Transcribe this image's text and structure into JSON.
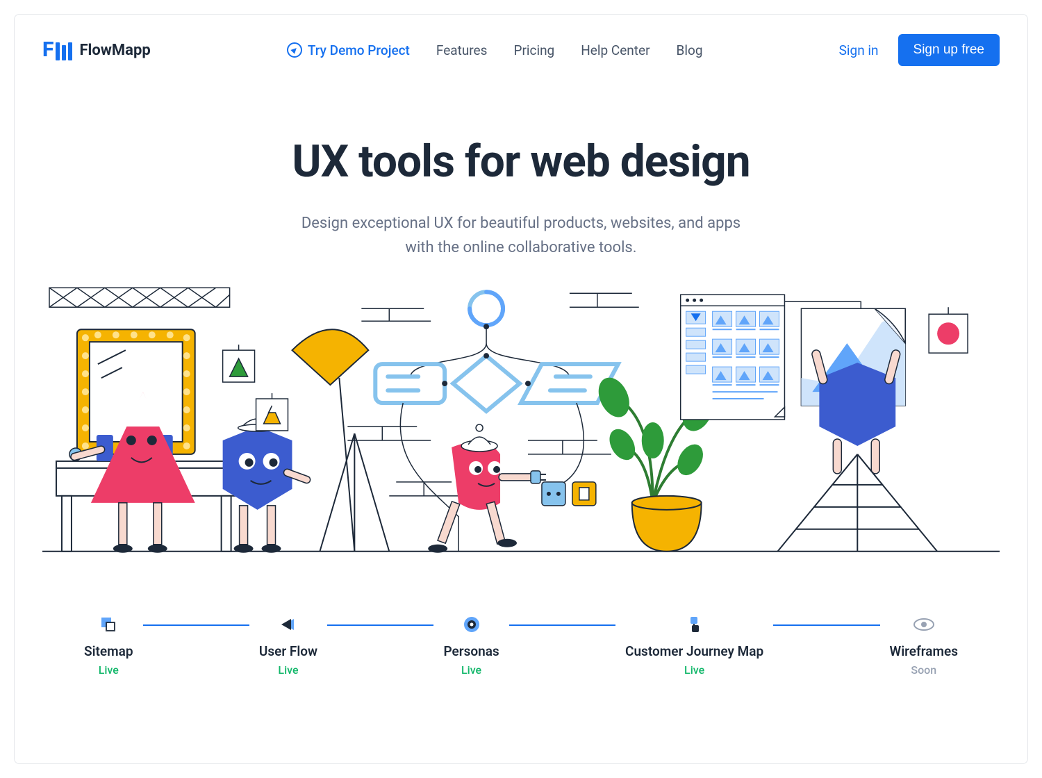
{
  "brand": {
    "name": "FlowMapp"
  },
  "nav": {
    "demo": "Try Demo Project",
    "features": "Features",
    "pricing": "Pricing",
    "help": "Help Center",
    "blog": "Blog"
  },
  "auth": {
    "signin": "Sign in",
    "signup": "Sign up free"
  },
  "hero": {
    "title": "UX tools for web design",
    "subtitle_line1": "Design exceptional UX for beautiful products, websites, and apps",
    "subtitle_line2": "with the online collaborative tools."
  },
  "features": [
    {
      "label": "Sitemap",
      "status": "Live",
      "status_class": "live"
    },
    {
      "label": "User Flow",
      "status": "Live",
      "status_class": "live"
    },
    {
      "label": "Personas",
      "status": "Live",
      "status_class": "live"
    },
    {
      "label": "Customer Journey Map",
      "status": "Live",
      "status_class": "live"
    },
    {
      "label": "Wireframes",
      "status": "Soon",
      "status_class": "soon"
    }
  ],
  "colors": {
    "primary": "#1570ef",
    "accent_yellow": "#f5b301",
    "accent_pink": "#ed3d68",
    "accent_blue": "#3c5ccf",
    "accent_lightblue": "#86c3ed",
    "green": "#12b76a"
  }
}
